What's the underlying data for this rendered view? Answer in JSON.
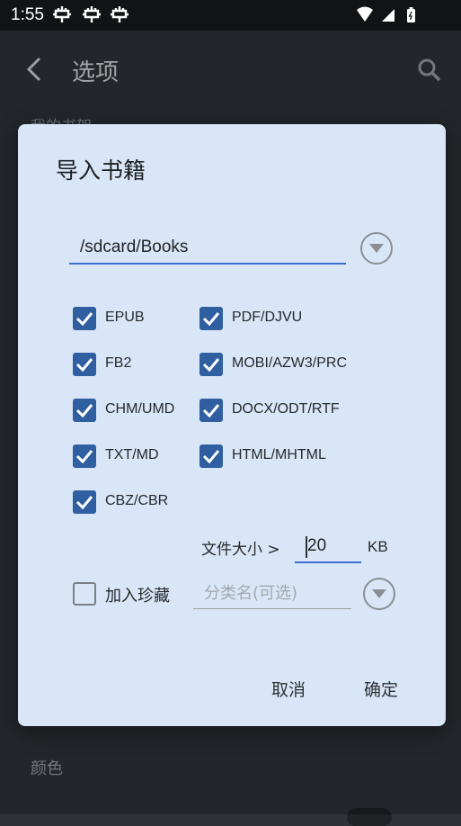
{
  "status_bar": {
    "time": "1:55",
    "notification_icons": [
      "bug-icon",
      "bug-icon",
      "bug-icon"
    ]
  },
  "app_bar": {
    "title": "选项"
  },
  "background": {
    "section_top": "我的书架",
    "section_bottom": "颜色"
  },
  "dialog": {
    "title": "导入书籍",
    "path": "/sdcard/Books",
    "formats": [
      {
        "label": "EPUB",
        "checked": true
      },
      {
        "label": "PDF/DJVU",
        "checked": true
      },
      {
        "label": "FB2",
        "checked": true
      },
      {
        "label": "MOBI/AZW3/PRC",
        "checked": true
      },
      {
        "label": "CHM/UMD",
        "checked": true
      },
      {
        "label": "DOCX/ODT/RTF",
        "checked": true
      },
      {
        "label": "TXT/MD",
        "checked": true
      },
      {
        "label": "HTML/MHTML",
        "checked": true
      },
      {
        "label": "CBZ/CBR",
        "checked": true
      }
    ],
    "file_size_label": "文件大小 >",
    "file_size_value": "20",
    "file_size_unit": "KB",
    "favorite_label": "加入珍藏",
    "favorite_checked": false,
    "category_placeholder": "分类名(可选)",
    "cancel_label": "取消",
    "ok_label": "确定"
  },
  "colors": {
    "dialog_bg": "#d9e6f7",
    "checkbox_checked": "#2f5fa0",
    "underline_active": "#3b6fd0"
  }
}
